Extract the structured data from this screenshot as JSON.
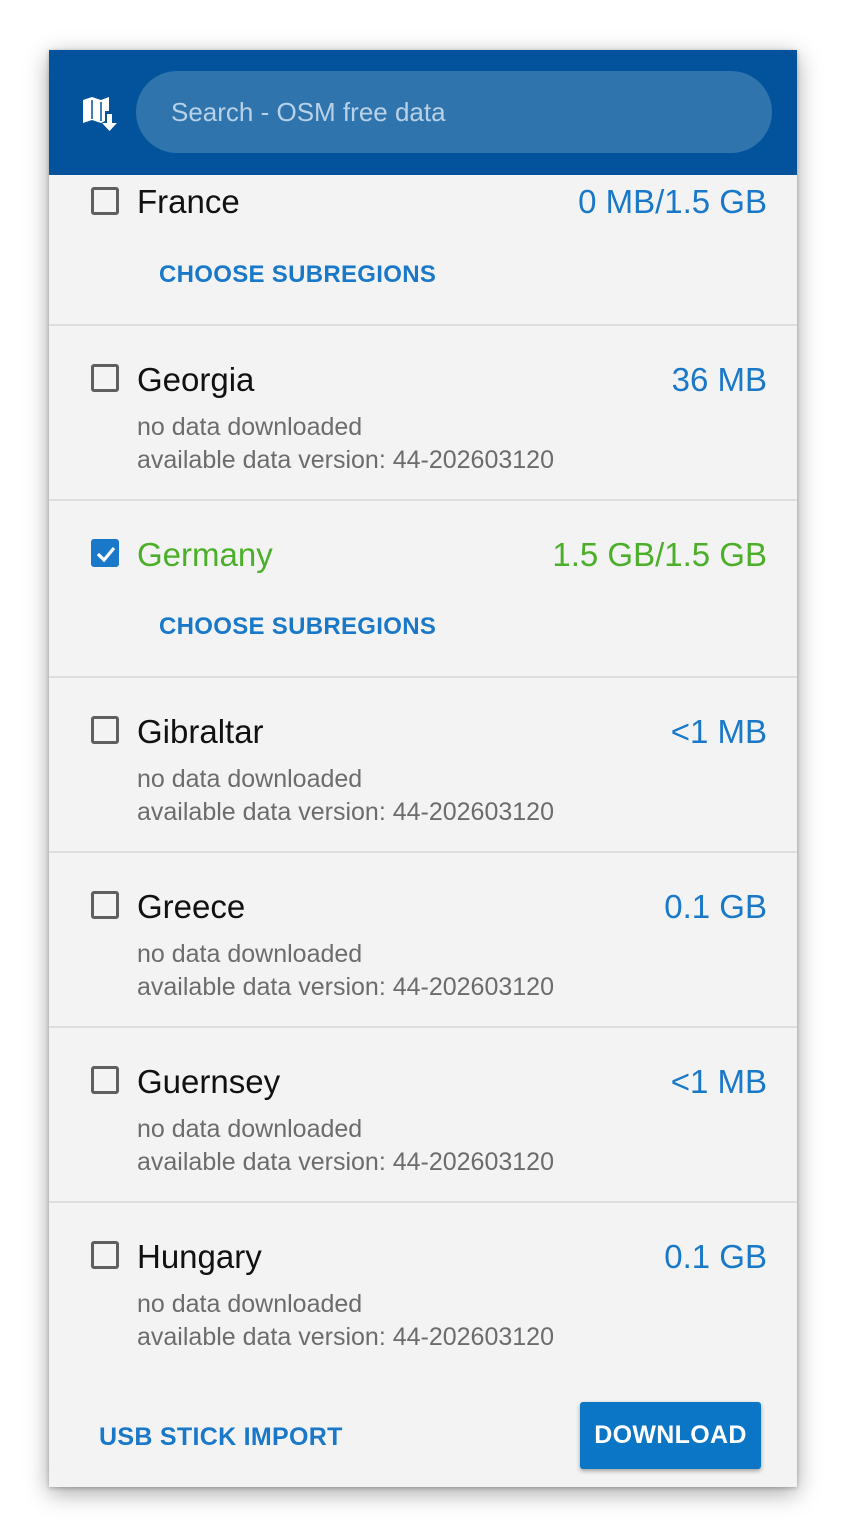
{
  "search": {
    "placeholder": "Search - OSM free data"
  },
  "regions": [
    {
      "name": "France",
      "size": "0 MB/1.5 GB",
      "checked": false,
      "action": "CHOOSE SUBREGIONS"
    },
    {
      "name": "Georgia",
      "size": "36 MB",
      "checked": false,
      "status": "no data downloaded",
      "version": "available data version: 44-202603120"
    },
    {
      "name": "Germany",
      "size": "1.5 GB/1.5 GB",
      "checked": true,
      "action": "CHOOSE SUBREGIONS"
    },
    {
      "name": "Gibraltar",
      "size": "<1 MB",
      "checked": false,
      "status": "no data downloaded",
      "version": "available data version: 44-202603120"
    },
    {
      "name": "Greece",
      "size": "0.1 GB",
      "checked": false,
      "status": "no data downloaded",
      "version": "available data version: 44-202603120"
    },
    {
      "name": "Guernsey",
      "size": "<1 MB",
      "checked": false,
      "status": "no data downloaded",
      "version": "available data version: 44-202603120"
    },
    {
      "name": "Hungary",
      "size": "0.1 GB",
      "checked": false,
      "status": "no data downloaded",
      "version": "available data version: 44-202603120"
    }
  ],
  "footer": {
    "usb_label": "USB STICK IMPORT",
    "download_label": "DOWNLOAD"
  },
  "colors": {
    "header": "#02539c",
    "accent": "#1a78c8",
    "installed": "#4caf2a"
  }
}
